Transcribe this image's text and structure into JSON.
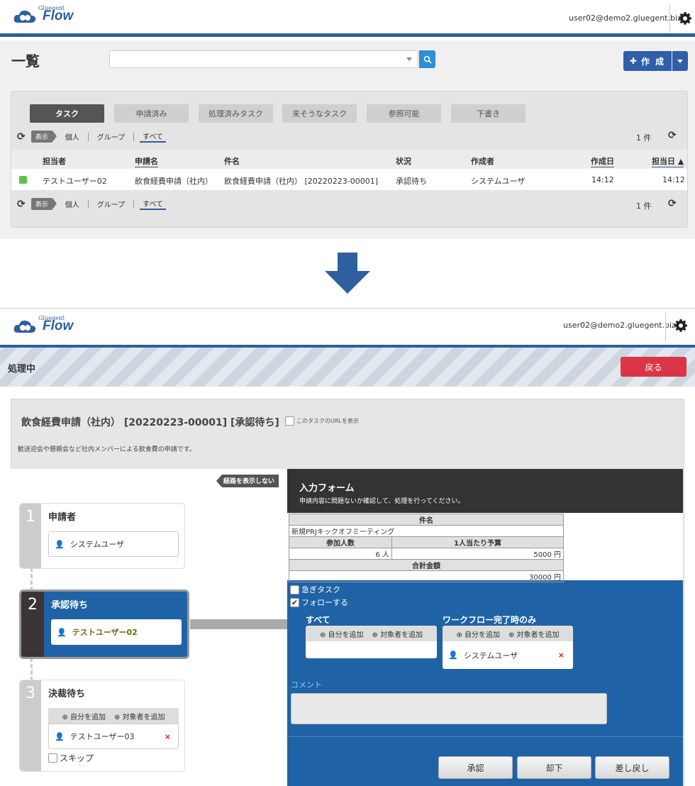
{
  "screen1": {
    "brand_small": "Gluegent",
    "brand": "Flow",
    "user": "user02@demo2.gluegent.biz",
    "page_title": "一覧",
    "search_value": "",
    "create_button": "作 成",
    "tabs": [
      "タスク",
      "申請済み",
      "処理済みタスク",
      "来そうなタスク",
      "参照可能",
      "下書き"
    ],
    "display_badge": "表示",
    "filters": [
      "個人",
      "グループ",
      "すべて"
    ],
    "count": "1 件",
    "columns": [
      "担当者",
      "申請名",
      "件名",
      "状況",
      "作成者",
      "作成日",
      "担当日 ▲"
    ],
    "row": {
      "assignee": "テストユーザー02",
      "app": "飲食経費申請（社内）",
      "subject": "飲食経費申請（社内） [20220223-00001]",
      "status": "承認待ち",
      "creator": "システムユーザ",
      "created": "14:12",
      "assigned": "14:12"
    }
  },
  "screen2": {
    "brand_small": "Gluegent",
    "brand": "Flow",
    "user": "user02@demo2.gluegent.biz",
    "status_title": "処理中",
    "back_button": "戻る",
    "request_title": "飲食経費申請（社内） [20220223-00001] [承認待ち]",
    "show_url": "このタスクのURLを表示",
    "description": "歓送迎会や懇親会など社内メンバーによる飲食費の申請です。",
    "hide_route": "経路を表示しない",
    "steps": [
      {
        "num": "1",
        "title": "申請者",
        "person": "システムユーザ"
      },
      {
        "num": "2",
        "title": "承認待ち",
        "person": "テストユーザー02"
      },
      {
        "num": "3",
        "title": "決裁待ち",
        "person": "テストユーザー03",
        "skip": "スキップ"
      }
    ],
    "add_self": "自分を追加",
    "add_target": "対象者を追加",
    "form_title": "入力フォーム",
    "form_sub": "申請内容に問題ないか確認して、処理を行ってください。",
    "table": {
      "subject_label": "件名",
      "subject_value": "新規PRJキックオフミーティング",
      "participants_label": "参加人数",
      "per_person_label": "1人当たり予算",
      "participants_value": "6",
      "participants_unit": "人",
      "per_person_value": "5000",
      "yen": "円",
      "total_label": "合計金額",
      "total_value": "30000"
    },
    "urgent_label": "急ぎタスク",
    "follow_label": "フォローする",
    "all_label": "すべて",
    "wf_done_label": "ワークフロー完了時のみ",
    "wf_person": "システムユーザ",
    "comment_label": "コメント",
    "comment_value": "",
    "approve": "承認",
    "reject": "却下",
    "sendback": "差し戻し"
  },
  "colors": {
    "brand_blue": "#2e5f9e",
    "accent_blue": "#1f63a6",
    "danger": "#dc3545",
    "status_green": "#5cc44a"
  }
}
